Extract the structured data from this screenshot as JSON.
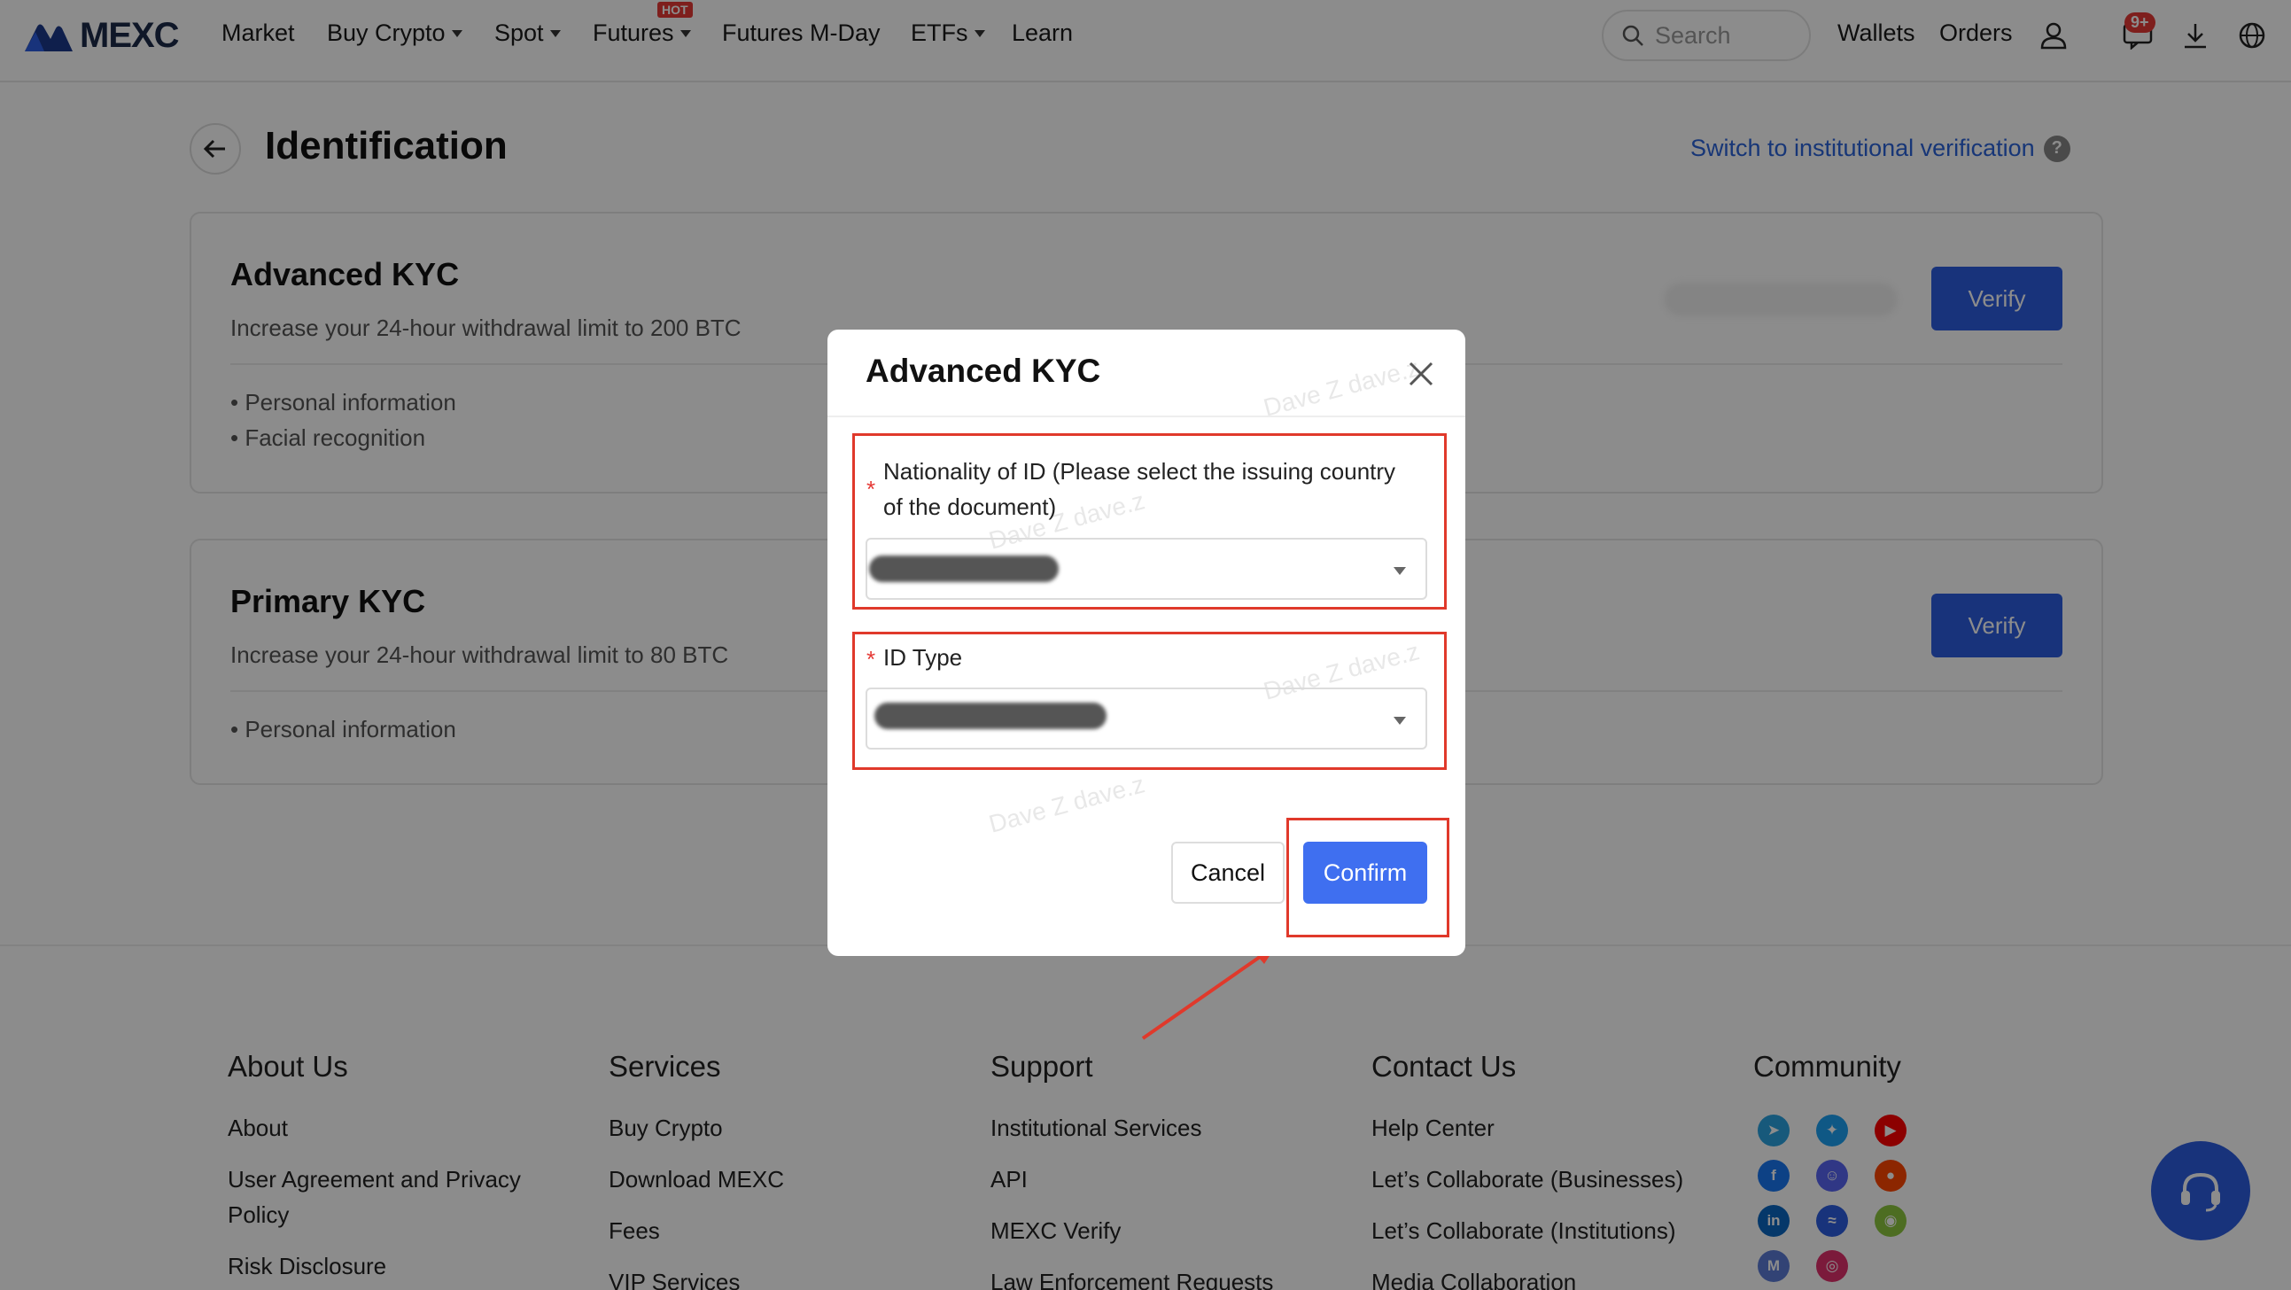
{
  "nav": {
    "brand": "MEXC",
    "items": [
      "Market",
      "Buy Crypto",
      "Spot",
      "Futures",
      "Futures M-Day",
      "ETFs",
      "Learn"
    ],
    "hot_label": "HOT",
    "search_placeholder": "Search",
    "wallets": "Wallets",
    "orders": "Orders",
    "notification_count": "9+"
  },
  "page": {
    "title": "Identification",
    "switch_link": "Switch to institutional verification",
    "help_glyph": "?",
    "advanced": {
      "title": "Advanced KYC",
      "subtitle": "Increase your 24-hour withdrawal limit to 200 BTC",
      "bullets": [
        "• Personal information",
        "• Facial recognition"
      ],
      "button": "Verify"
    },
    "primary": {
      "title": "Primary KYC",
      "subtitle": "Increase your 24-hour withdrawal limit to 80 BTC",
      "bullets": [
        "• Personal information"
      ],
      "button": "Verify"
    }
  },
  "modal": {
    "title": "Advanced KYC",
    "nationality_label_1": "Nationality of ID (Please select the issuing country",
    "nationality_label_2": "of the document)",
    "id_type_label": "ID Type",
    "required_mark": "*",
    "cancel": "Cancel",
    "confirm": "Confirm",
    "watermark": "Dave Z dave.z"
  },
  "footer": {
    "columns": [
      {
        "heading": "About Us",
        "links": [
          "About",
          "User Agreement and Privacy",
          "Policy",
          "Risk Disclosure"
        ]
      },
      {
        "heading": "Services",
        "links": [
          "Buy Crypto",
          "Download MEXC",
          "Fees",
          "VIP Services"
        ]
      },
      {
        "heading": "Support",
        "links": [
          "Institutional Services",
          "API",
          "MEXC Verify",
          "Law Enforcement Requests"
        ]
      },
      {
        "heading": "Contact Us",
        "links": [
          "Help Center",
          "Let’s Collaborate (Businesses)",
          "Let’s Collaborate (Institutions)",
          "Media Collaboration"
        ]
      },
      {
        "heading": "Community",
        "links": []
      }
    ],
    "social_icons": [
      "telegram-icon",
      "twitter-icon",
      "youtube-icon",
      "facebook-icon",
      "discord-icon",
      "reddit-icon",
      "linkedin-icon",
      "messenger-icon",
      "coingecko-icon",
      "medium-icon",
      "instagram-icon"
    ]
  },
  "colors": {
    "accent": "#2d5de0",
    "confirm": "#3f6ff0",
    "highlight": "#e0392b",
    "link": "#2a63d9"
  }
}
